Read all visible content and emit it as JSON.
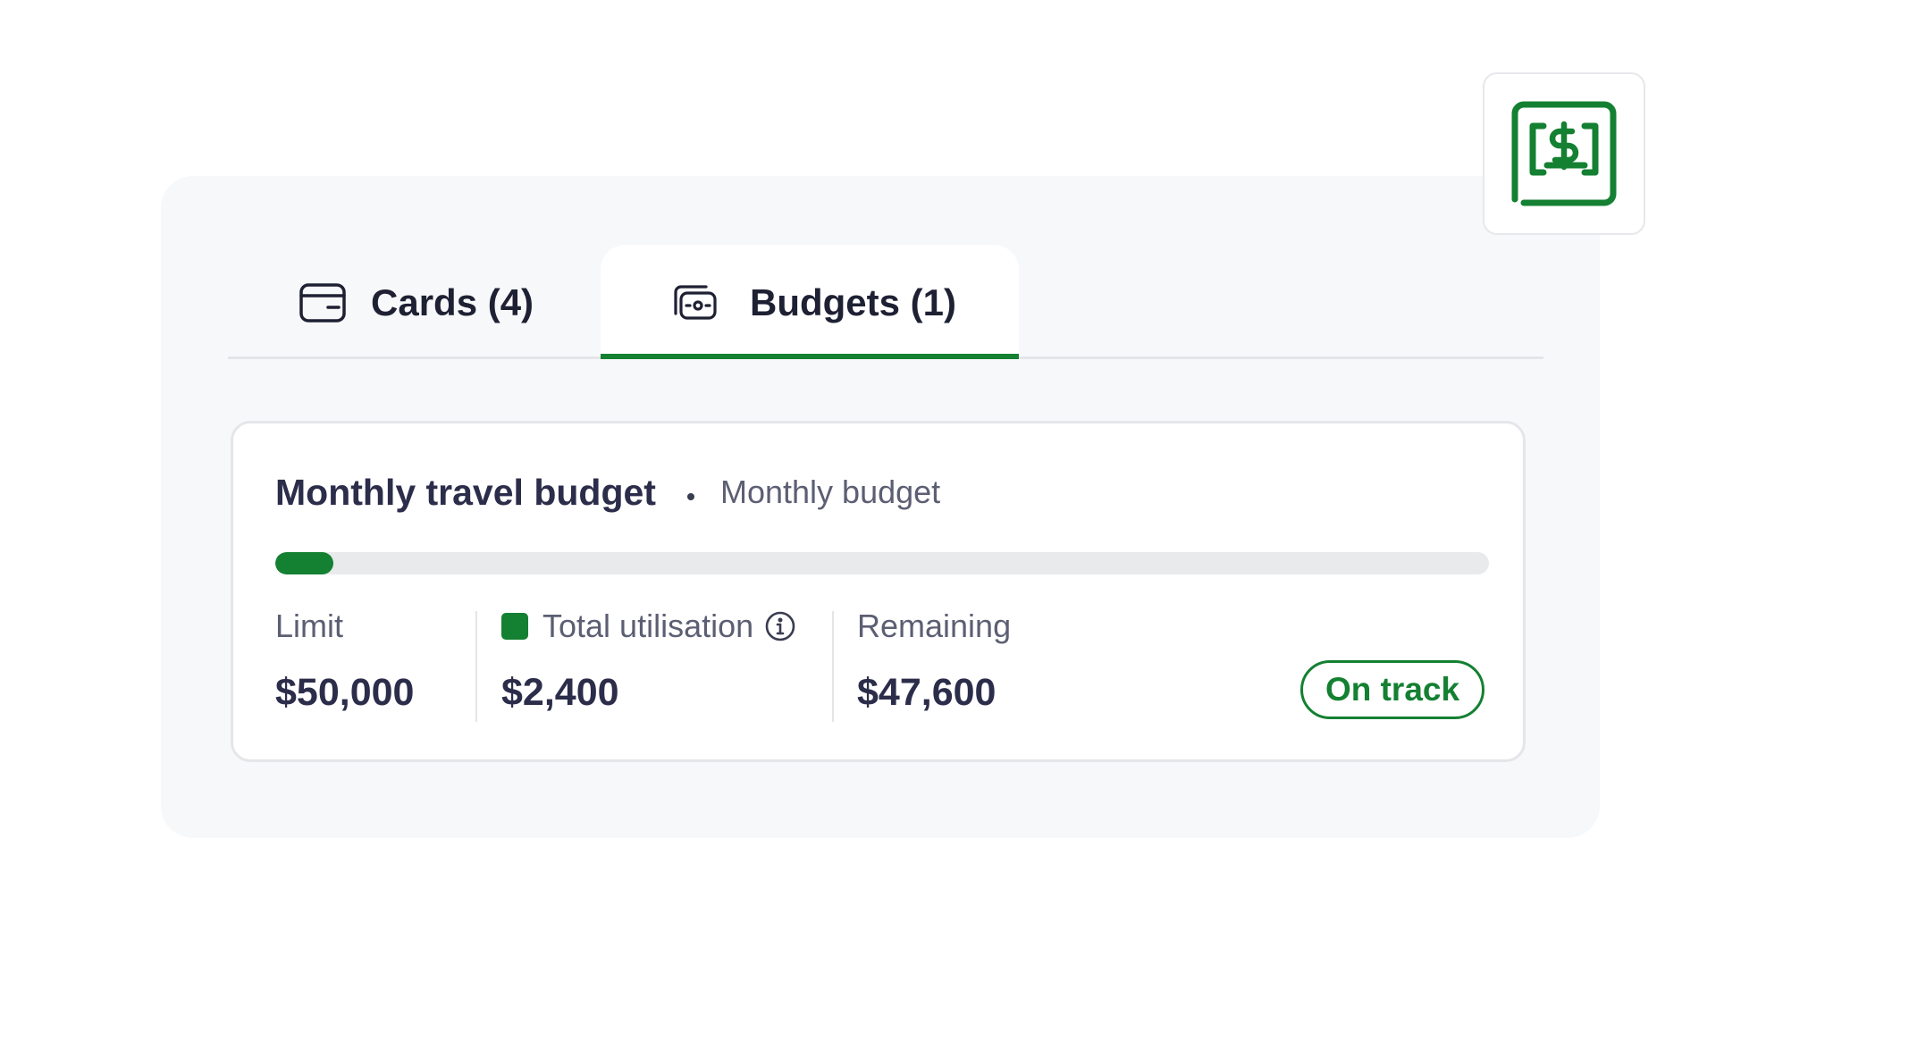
{
  "tabs": [
    {
      "label": "Cards (4)",
      "icon": "card-icon",
      "active": false
    },
    {
      "label": "Budgets (1)",
      "icon": "cash-icon",
      "active": true
    }
  ],
  "budget": {
    "title": "Monthly travel budget",
    "type": "Monthly budget",
    "progress_fraction": 0.048,
    "limit_label": "Limit",
    "limit_value": "$50,000",
    "utilisation_label": "Total utilisation",
    "utilisation_value": "$2,400",
    "remaining_label": "Remaining",
    "remaining_value": "$47,600",
    "status": "On track"
  },
  "logo": {
    "icon": "dollar-frame-icon"
  },
  "colors": {
    "accent": "#148032",
    "panel_bg": "#f7f8f9",
    "text_dark": "#2b2d4a",
    "text_muted": "#5c5f73"
  }
}
